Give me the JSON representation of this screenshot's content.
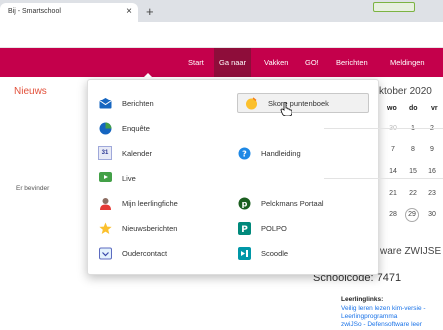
{
  "browser": {
    "tab_title": "Bij - Smartschool",
    "tab_close": "×",
    "new_tab": "+"
  },
  "navbar": {
    "items": [
      {
        "label": "Start"
      },
      {
        "label": "Ga naar"
      },
      {
        "label": "Vakken"
      },
      {
        "label": "GO!"
      },
      {
        "label": "Berichten"
      },
      {
        "label": "Meldingen"
      }
    ]
  },
  "main": {
    "news_title": "Nieuws",
    "side_text": "Er bevinder"
  },
  "calendar": {
    "month_title": "ktober 2020",
    "headers": [
      "wo",
      "do",
      "vr"
    ],
    "rows": [
      [
        "30",
        "1",
        "2"
      ],
      [
        "7",
        "8",
        "9"
      ],
      [
        "14",
        "15",
        "16"
      ],
      [
        "21",
        "22",
        "23"
      ],
      [
        "28",
        "29",
        "30"
      ]
    ]
  },
  "sidebar": {
    "section_title": "ware ZWIJSE",
    "school_code": "Schoolcode: 7471",
    "links_title": "Leerlinglinks:",
    "links": [
      "Veilig leren lezen kim-versie -",
      "Leerlingprogramma",
      "zwiJSo - Defensoftware leer"
    ]
  },
  "dropdown": {
    "left_items": [
      {
        "label": "Berichten",
        "icon": "envelope-icon"
      },
      {
        "label": "Enquête",
        "icon": "pie-chart-icon"
      },
      {
        "label": "Kalender",
        "icon": "calendar-icon",
        "badge": "31"
      },
      {
        "label": "Live",
        "icon": "live-video-icon"
      },
      {
        "label": "Mijn leerlingfiche",
        "icon": "student-icon"
      },
      {
        "label": "Nieuwsberichten",
        "icon": "star-icon"
      },
      {
        "label": "Oudercontact",
        "icon": "parent-contact-icon"
      }
    ],
    "right_items": [
      {
        "label": "Skore puntenboek",
        "icon": "skore-icon"
      },
      {
        "label": "Handleiding",
        "icon": "help-icon"
      },
      {
        "label": "Pelckmans Portaal",
        "icon": "pelckmans-icon"
      },
      {
        "label": "POLPO",
        "icon": "polpo-icon"
      },
      {
        "label": "Scoodle",
        "icon": "scoodle-icon"
      }
    ]
  },
  "colors": {
    "brand": "#c4004b",
    "nav_active": "#8e0d3a",
    "news_title": "#e2513b",
    "link": "#1a73e8"
  }
}
